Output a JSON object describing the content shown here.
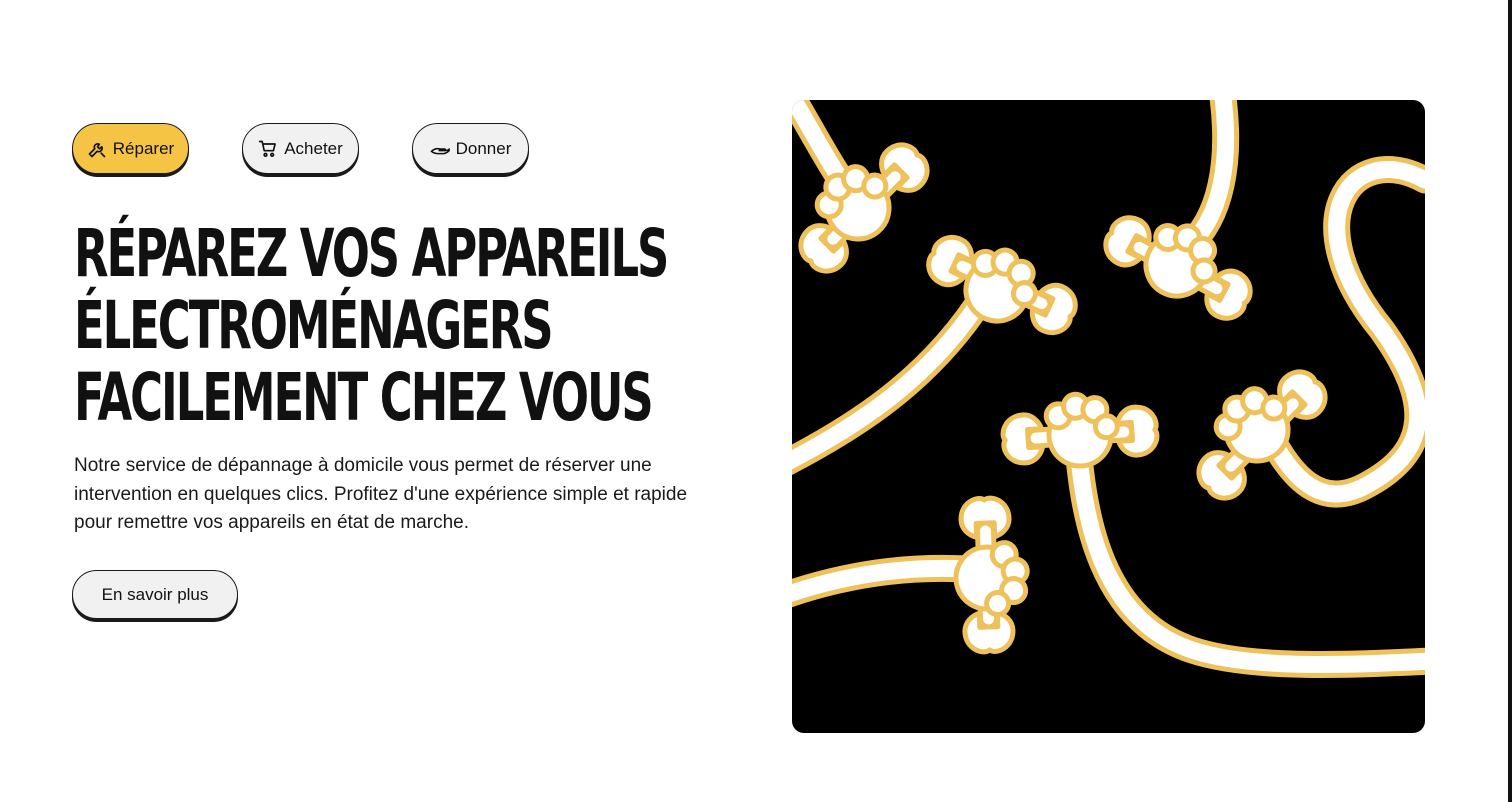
{
  "tabs": [
    {
      "label": "Réparer",
      "icon": "wrench-icon",
      "active": true
    },
    {
      "label": "Acheter",
      "icon": "cart-icon",
      "active": false
    },
    {
      "label": "Donner",
      "icon": "giving-hand-icon",
      "active": false
    }
  ],
  "hero": {
    "headline_lines": [
      "Réparez vos appareils",
      "électroménagers",
      "facilement chez vous"
    ],
    "description": "Notre service de dépannage à domicile vous permet de réserver une intervention en quelques clics. Profitez d'une expérience simple et rapide pour remettre vos appareils en état de marche.",
    "cta_label": "En savoir plus"
  },
  "colors": {
    "accent": "#f6c445",
    "button_bg": "#f1f1f1",
    "illustration_bg": "#000000",
    "illustration_stroke": "#efc15a",
    "text": "#111111"
  }
}
